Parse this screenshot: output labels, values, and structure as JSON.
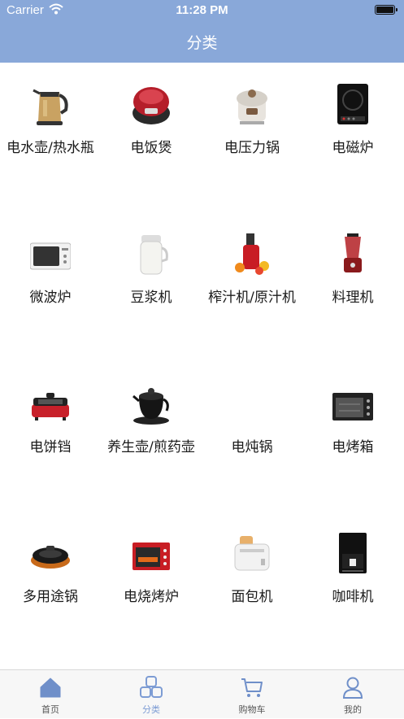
{
  "status": {
    "carrier": "Carrier",
    "time": "11:28 PM"
  },
  "header": {
    "title": "分类"
  },
  "categories": [
    {
      "label": "电水壶/热水瓶",
      "icon": "kettle-icon"
    },
    {
      "label": "电饭煲",
      "icon": "rice-cooker-icon"
    },
    {
      "label": "电压力锅",
      "icon": "pressure-cooker-icon"
    },
    {
      "label": "电磁炉",
      "icon": "induction-cooker-icon"
    },
    {
      "label": "微波炉",
      "icon": "microwave-icon"
    },
    {
      "label": "豆浆机",
      "icon": "soymilk-maker-icon"
    },
    {
      "label": "榨汁机/原汁机",
      "icon": "juicer-icon"
    },
    {
      "label": "料理机",
      "icon": "blender-icon"
    },
    {
      "label": "电饼铛",
      "icon": "griddle-icon"
    },
    {
      "label": "养生壶/煎药壶",
      "icon": "health-pot-icon"
    },
    {
      "label": "电炖锅",
      "icon": ""
    },
    {
      "label": "电烤箱",
      "icon": "oven-icon"
    },
    {
      "label": "多用途锅",
      "icon": "multi-pot-icon"
    },
    {
      "label": "电烧烤炉",
      "icon": "electric-grill-icon"
    },
    {
      "label": "面包机",
      "icon": "bread-maker-icon"
    },
    {
      "label": "咖啡机",
      "icon": "coffee-machine-icon"
    }
  ],
  "tabbar": {
    "tabs": [
      {
        "label": "首页",
        "icon": "home-icon"
      },
      {
        "label": "分类",
        "icon": "category-icon",
        "active": true
      },
      {
        "label": "购物车",
        "icon": "cart-icon"
      },
      {
        "label": "我的",
        "icon": "profile-icon"
      }
    ]
  },
  "colors": {
    "header": "#89a8d9",
    "accent": "#7d9cd4",
    "tab_inactive": "#9aa3b0"
  }
}
